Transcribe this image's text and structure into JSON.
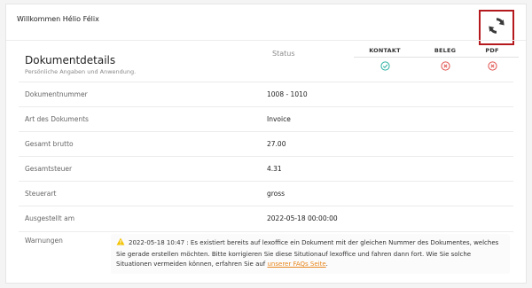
{
  "header": {
    "welcome": "Willkommen Hélio Félix",
    "refresh_icon": "sync-icon"
  },
  "section": {
    "title": "Dokumentdetails",
    "subtitle": "Persönliche Angaben und Anwendung.",
    "status_label": "Status"
  },
  "status": {
    "columns": [
      {
        "label": "KONTAKT",
        "state": "ok",
        "icon": "check-circle-icon",
        "color": "#2bb3a3"
      },
      {
        "label": "BELEG",
        "state": "error",
        "icon": "x-circle-icon",
        "color": "#e0534f"
      },
      {
        "label": "PDF",
        "state": "error",
        "icon": "x-circle-icon",
        "color": "#e0534f"
      }
    ]
  },
  "details": {
    "rows": [
      {
        "label": "Dokumentnummer",
        "value": "1008 - 1010"
      },
      {
        "label": "Art des Dokuments",
        "value": "Invoice"
      },
      {
        "label": "Gesamt brutto",
        "value": "27.00"
      },
      {
        "label": "Gesamtsteuer",
        "value": "4.31"
      },
      {
        "label": "Steuerart",
        "value": "gross"
      },
      {
        "label": "Ausgestellt am",
        "value": "2022-05-18 00:00:00"
      }
    ]
  },
  "warnings": {
    "label": "Warnungen",
    "icon": "warning-triangle-icon",
    "timestamp": "2022-05-18 10:47",
    "message": ": Es existiert bereits auf lexoffice ein Dokument mit der gleichen Nummer des Dokumentes, welches Sie gerade erstellen möchten. Bitte korrigieren Sie diese Situtionauf lexoffice und fahren dann fort. Wie Sie solche Situationen vermeiden können, erfahren Sie auf",
    "link_text": "unserer FAQs Seite",
    "message_end": "."
  },
  "colors": {
    "accent_border": "#b5191e",
    "ok": "#2bb3a3",
    "error": "#e0534f",
    "warning": "#f2c200",
    "link": "#e8871e"
  }
}
